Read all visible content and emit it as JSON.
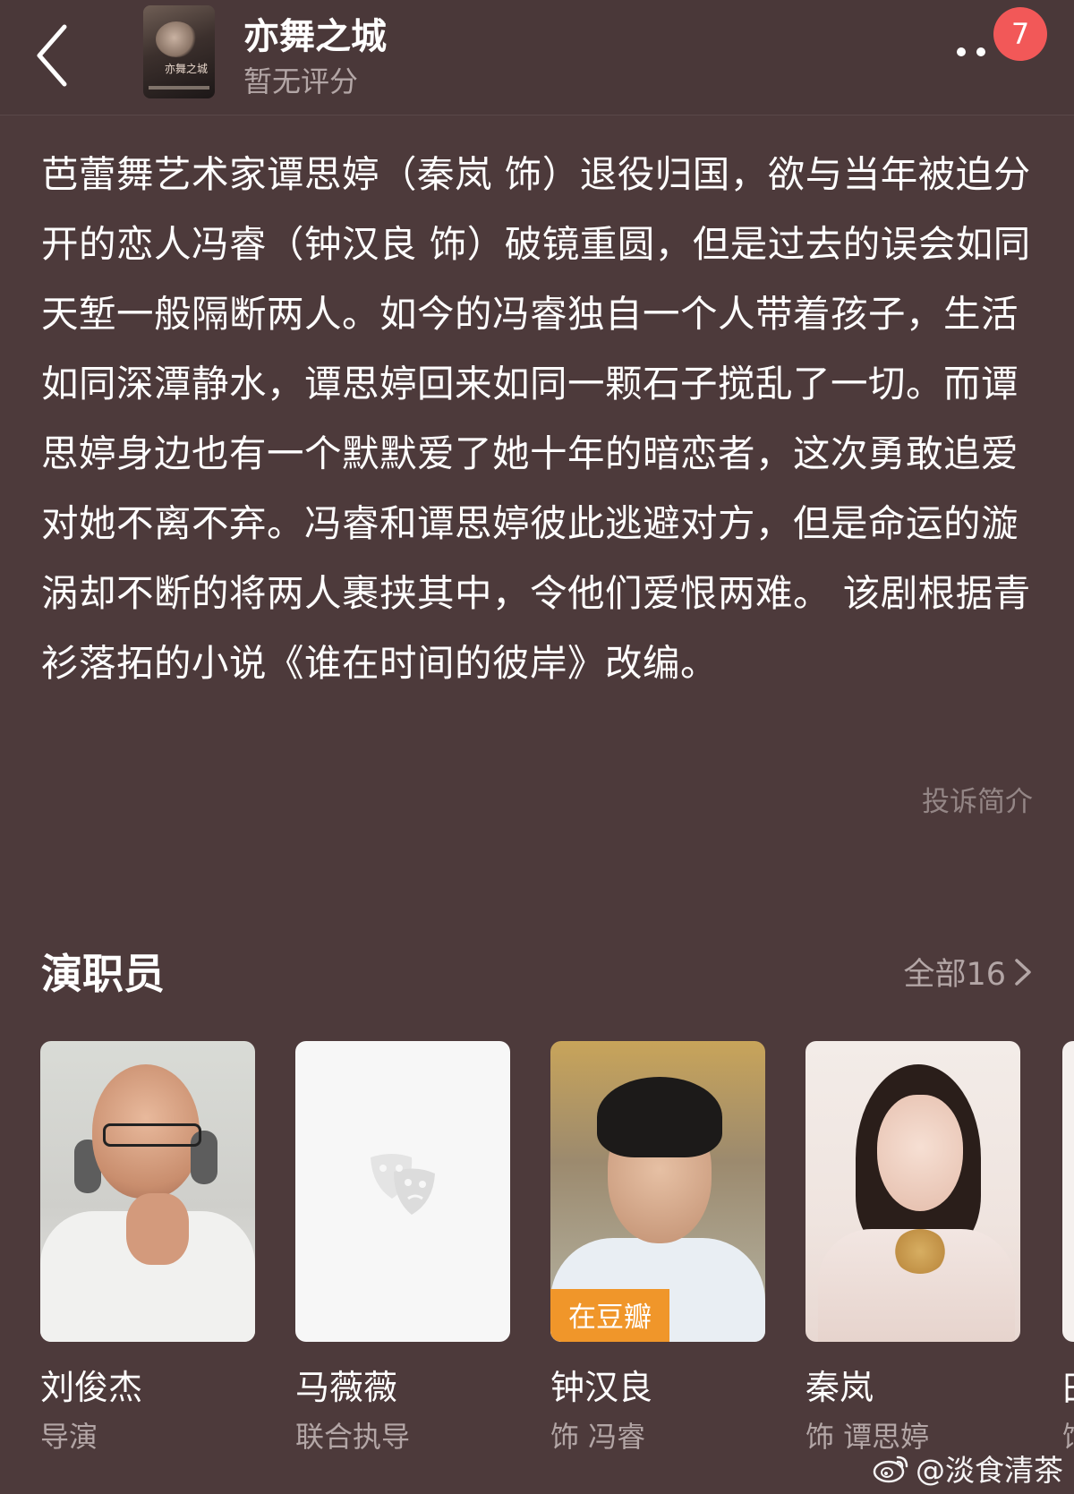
{
  "header": {
    "title": "亦舞之城",
    "rating": "暂无评分",
    "notification_count": "7",
    "poster_title": "亦舞之城"
  },
  "synopsis": {
    "text": "芭蕾舞艺术家谭思婷（秦岚 饰）退役归国，欲与当年被迫分开的恋人冯睿（钟汉良 饰）破镜重圆，但是过去的误会如同天堑一般隔断两人。如今的冯睿独自一个人带着孩子，生活如同深潭静水，谭思婷回来如同一颗石子搅乱了一切。而谭思婷身边也有一个默默爱了她十年的暗恋者，这次勇敢追爱对她不离不弃。冯睿和谭思婷彼此逃避对方，但是命运的漩涡却不断的将两人裹挟其中，令他们爱恨两难。 该剧根据青衫落拓的小说《谁在时间的彼岸》改编。",
    "report_label": "投诉简介"
  },
  "cast": {
    "header": "演职员",
    "all_label": "全部16",
    "members": [
      {
        "name": "刘俊杰",
        "role": "导演"
      },
      {
        "name": "马薇薇",
        "role": "联合执导"
      },
      {
        "name": "钟汉良",
        "role": "饰 冯睿",
        "tag": "在豆瓣"
      },
      {
        "name": "秦岚",
        "role": "饰 谭思婷"
      },
      {
        "name": "田",
        "role": "饰"
      }
    ]
  },
  "watermark": "@淡食清茶",
  "colors": {
    "background": "#4d3a3b",
    "badge": "#f25858",
    "douban_tag": "#f0962a",
    "secondary_text": "#b3a6a6"
  },
  "icons": [
    "chevron-left-icon",
    "more-icon",
    "chevron-right-icon",
    "theater-mask-icon",
    "weibo-icon"
  ]
}
